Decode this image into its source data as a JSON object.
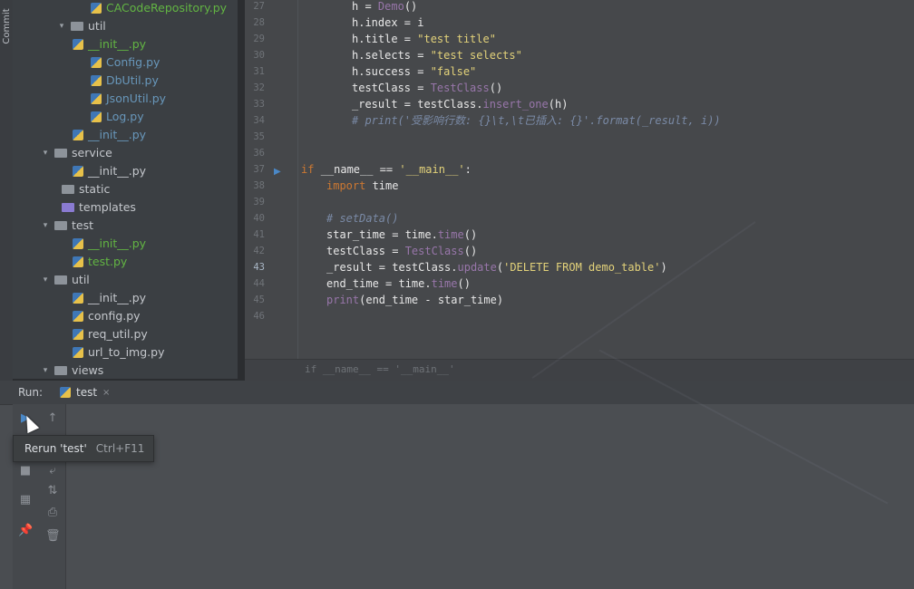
{
  "left_strip": {
    "commit_label": "Commit"
  },
  "tree": {
    "rows": [
      {
        "label": "CACodeRepository.py",
        "kind": "py",
        "color": "green"
      },
      {
        "label": "util",
        "kind": "folder-pkg",
        "expanded": true
      },
      {
        "label": "__init__.py",
        "kind": "py",
        "color": "green"
      },
      {
        "label": "Config.py",
        "kind": "py",
        "color": "blue"
      },
      {
        "label": "DbUtil.py",
        "kind": "py",
        "color": "blue"
      },
      {
        "label": "JsonUtil.py",
        "kind": "py",
        "color": "blue"
      },
      {
        "label": "Log.py",
        "kind": "py",
        "color": "blue"
      },
      {
        "label": "__init__.py",
        "kind": "py",
        "color": "blue"
      },
      {
        "label": "service",
        "kind": "folder-pkg",
        "expanded": true
      },
      {
        "label": "__init__.py",
        "kind": "py",
        "color": "plain"
      },
      {
        "label": "static",
        "kind": "folder",
        "expanded": false
      },
      {
        "label": "templates",
        "kind": "folder-purple",
        "expanded": false
      },
      {
        "label": "test",
        "kind": "folder-pkg",
        "expanded": true
      },
      {
        "label": "__init__.py",
        "kind": "py",
        "color": "green"
      },
      {
        "label": "test.py",
        "kind": "py",
        "color": "green"
      },
      {
        "label": "util",
        "kind": "folder-pkg",
        "expanded": true
      },
      {
        "label": "__init__.py",
        "kind": "py",
        "color": "plain"
      },
      {
        "label": "config.py",
        "kind": "py",
        "color": "plain"
      },
      {
        "label": "req_util.py",
        "kind": "py",
        "color": "plain"
      },
      {
        "label": "url_to_img.py",
        "kind": "py",
        "color": "plain"
      },
      {
        "label": "views",
        "kind": "folder-pkg",
        "expanded": true
      }
    ]
  },
  "editor": {
    "line_numbers": [
      "27",
      "28",
      "29",
      "30",
      "31",
      "32",
      "33",
      "34",
      "35",
      "36",
      "37",
      "38",
      "39",
      "40",
      "41",
      "42",
      "43",
      "44",
      "45",
      "46"
    ],
    "current_line": "43",
    "lines": [
      [
        {
          "t": "h = ",
          "c": ""
        },
        {
          "t": "Demo",
          "c": "cls"
        },
        {
          "t": "()",
          "c": ""
        }
      ],
      [
        {
          "t": "h.index = i",
          "c": ""
        }
      ],
      [
        {
          "t": "h.title = ",
          "c": ""
        },
        {
          "t": "\"test title\"",
          "c": "str"
        }
      ],
      [
        {
          "t": "h.selects = ",
          "c": ""
        },
        {
          "t": "\"test selects\"",
          "c": "str"
        }
      ],
      [
        {
          "t": "h.success = ",
          "c": ""
        },
        {
          "t": "\"false\"",
          "c": "str"
        }
      ],
      [
        {
          "t": "testClass = ",
          "c": ""
        },
        {
          "t": "TestClass",
          "c": "cls"
        },
        {
          "t": "()",
          "c": ""
        }
      ],
      [
        {
          "t": "_result = testClass.",
          "c": ""
        },
        {
          "t": "insert_one",
          "c": "cls"
        },
        {
          "t": "(h)",
          "c": ""
        }
      ],
      [
        {
          "t": "# print('受影响行数: {}\\t,\\t已插入: {}'.format(_result, i))",
          "c": "cmt"
        }
      ],
      [
        {
          "t": "",
          "c": ""
        }
      ],
      [
        {
          "t": "",
          "c": ""
        }
      ],
      [
        {
          "t": "if ",
          "c": "kw"
        },
        {
          "t": "__name__ == ",
          "c": ""
        },
        {
          "t": "'__main__'",
          "c": "str"
        },
        {
          "t": ":",
          "c": ""
        }
      ],
      [
        {
          "t": "import ",
          "c": "kw"
        },
        {
          "t": "time",
          "c": ""
        }
      ],
      [
        {
          "t": "",
          "c": ""
        }
      ],
      [
        {
          "t": "# setData()",
          "c": "cmt"
        }
      ],
      [
        {
          "t": "star_time = time.",
          "c": ""
        },
        {
          "t": "time",
          "c": "cls"
        },
        {
          "t": "()",
          "c": ""
        }
      ],
      [
        {
          "t": "testClass = ",
          "c": ""
        },
        {
          "t": "TestClass",
          "c": "cls"
        },
        {
          "t": "()",
          "c": ""
        }
      ],
      [
        {
          "t": "_result = testClass.",
          "c": ""
        },
        {
          "t": "update",
          "c": "cls"
        },
        {
          "t": "(",
          "c": ""
        },
        {
          "t": "'DELETE FROM demo_table'",
          "c": "str"
        },
        {
          "t": ")",
          "c": ""
        }
      ],
      [
        {
          "t": "end_time = time.",
          "c": ""
        },
        {
          "t": "time",
          "c": "cls"
        },
        {
          "t": "()",
          "c": ""
        }
      ],
      [
        {
          "t": "print",
          "c": "cls"
        },
        {
          "t": "(end_time - star_time)",
          "c": ""
        }
      ],
      [
        {
          "t": "",
          "c": ""
        }
      ]
    ],
    "indents": [
      2,
      2,
      2,
      2,
      2,
      2,
      2,
      2,
      0,
      0,
      0,
      1,
      0,
      1,
      1,
      1,
      1,
      1,
      1,
      0
    ],
    "breadcrumb": "if __name__ == '__main__'"
  },
  "run_panel": {
    "label": "Run:",
    "tab_label": "test",
    "tab_close": "×",
    "tooltip_text": "Rerun 'test'",
    "tooltip_shortcut": "Ctrl+F11",
    "toolbar": {
      "rerun_icon": "▶",
      "up_icon": "↑",
      "stop_icon": "■",
      "wrap_icon": "⤶",
      "layout_icon": "▦",
      "sort_icon": "⇅",
      "pin_icon": "📌",
      "print_icon": "⎙",
      "trash_icon": "🗑"
    }
  }
}
